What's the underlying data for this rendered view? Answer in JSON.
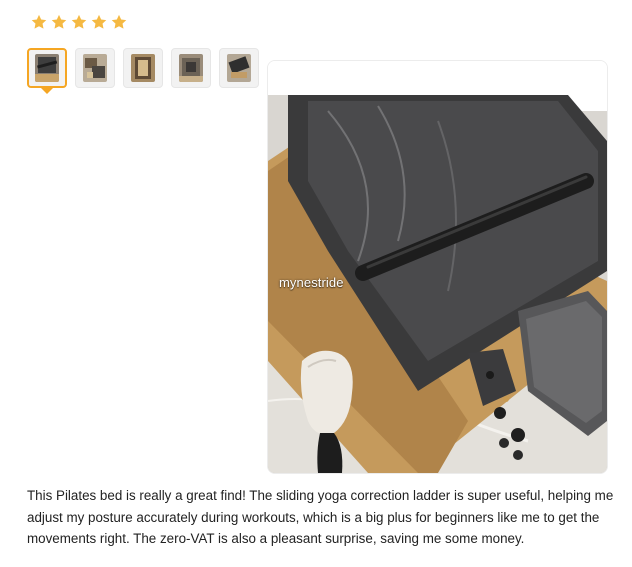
{
  "review": {
    "rating": 5,
    "rating_max": 5,
    "star_color": "#f5b942",
    "thumbnails": [
      {
        "name": "photo-1",
        "active": true
      },
      {
        "name": "photo-2",
        "active": false
      },
      {
        "name": "photo-3",
        "active": false
      },
      {
        "name": "photo-4",
        "active": false
      },
      {
        "name": "photo-5",
        "active": false
      }
    ],
    "active_accent": "#f5a623",
    "main_image": {
      "watermark": "mynestride"
    },
    "text": "This Pilates bed is really a great find! The sliding yoga correction ladder is super useful, helping me adjust my posture accurately during workouts, which is a big plus for beginners like me to get the movements right. The zero-VAT is also a pleasant surprise, saving me some money."
  }
}
